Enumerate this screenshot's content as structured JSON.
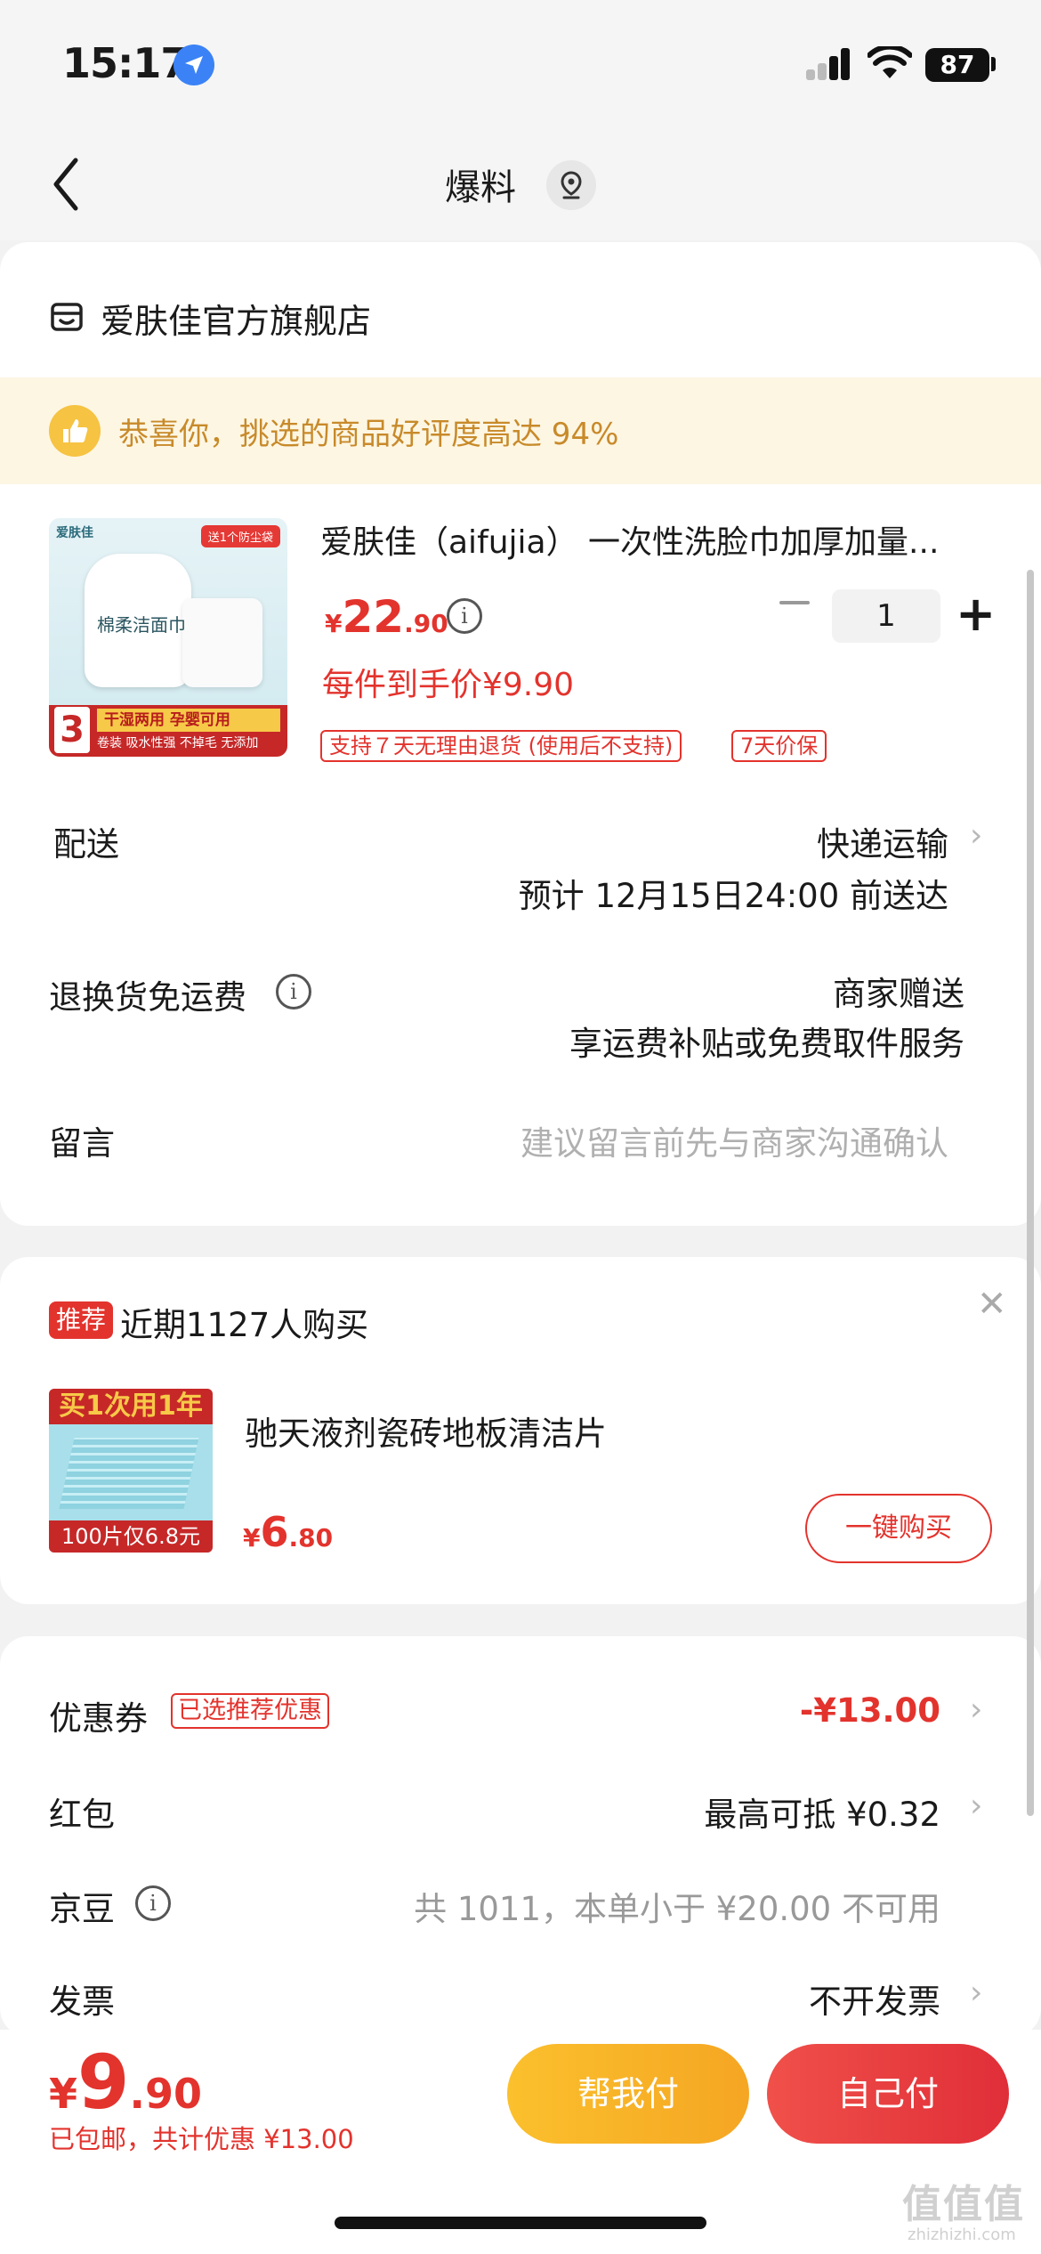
{
  "status_bar": {
    "time": "15:17",
    "battery": "87"
  },
  "nav": {
    "title": "爆料"
  },
  "shop": {
    "name": "爱肤佳官方旗舰店"
  },
  "banner": {
    "text": "恭喜你，挑选的商品好评度高达 94%"
  },
  "product": {
    "title": "爱肤佳（aifujia） 一次性洗脸巾加厚加量...",
    "image": {
      "brand": "爱肤佳",
      "ribbon": "送1个防尘袋",
      "name": "棉柔洁面巾",
      "count": "3",
      "yellow_text": "干湿两用 孕婴可用",
      "white_text": "卷装 吸水性强 不掉毛 无添加"
    },
    "price": {
      "symbol": "¥",
      "integer": "22",
      "decimal": ".90"
    },
    "unit_price": "每件到手价¥9.90",
    "tags": [
      "支持７天无理由退货 (使用后不支持)",
      "7天价保"
    ],
    "quantity": "1"
  },
  "delivery": {
    "label": "配送",
    "method": "快递运输",
    "eta": "预计 12月15日24:00 前送达"
  },
  "return_shipping": {
    "label": "退换货免运费",
    "line1": "商家赠送",
    "line2": "享运费补贴或免费取件服务"
  },
  "message": {
    "label": "留言",
    "placeholder": "建议留言前先与商家沟通确认"
  },
  "recommend": {
    "badge": "推荐",
    "text": "近期1127人购买",
    "image_top": "买1次用1年",
    "image_bottom": "100片仅6.8元",
    "name": "驰天液剂瓷砖地板清洁片",
    "price": {
      "symbol": "¥",
      "integer": "6",
      "decimal": ".80"
    },
    "button": "一键购买"
  },
  "summary": {
    "coupon": {
      "label": "优惠券",
      "tag": "已选推荐优惠",
      "value": "-¥13.00"
    },
    "red_packet": {
      "label": "红包",
      "value": "最高可抵 ¥0.32"
    },
    "jingdou": {
      "label": "京豆",
      "value": "共 1011，本单小于 ¥20.00 不可用"
    },
    "invoice": {
      "label": "发票",
      "value": "不开发票"
    }
  },
  "bottom": {
    "total": {
      "symbol": "¥",
      "integer": "9",
      "decimal": ".90"
    },
    "sub": "已包邮，共计优惠 ¥13.00",
    "help_pay": "帮我付",
    "self_pay": "自己付"
  },
  "watermark": {
    "main": "值值值",
    "sub": "zhizhizhi.com"
  },
  "colors": {
    "accent": "#e3332d",
    "gold": "#f5a623",
    "banner_bg": "#fdf6e3"
  }
}
